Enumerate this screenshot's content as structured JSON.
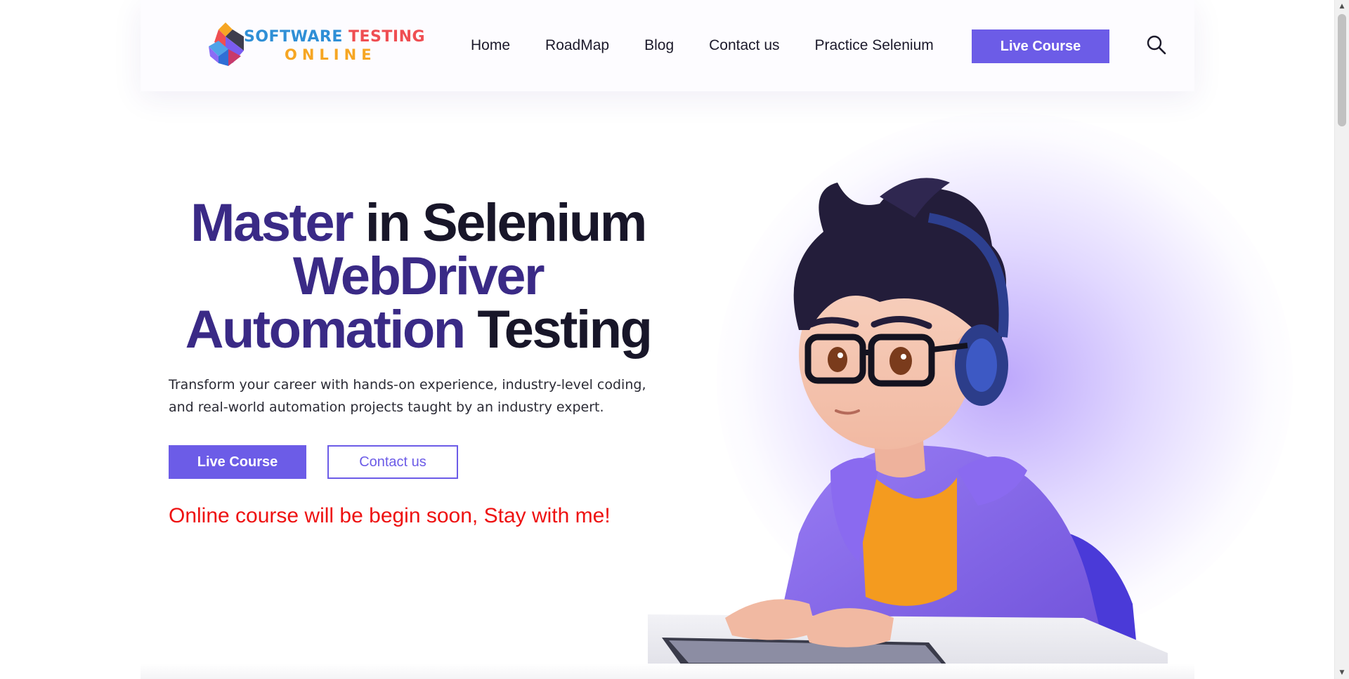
{
  "header": {
    "logo": {
      "line1_part1": "SOFTWARE ",
      "line1_part2": "TESTING",
      "line2": "ONLINE"
    },
    "nav": [
      "Home",
      "RoadMap",
      "Blog",
      "Contact us",
      "Practice Selenium"
    ],
    "cta_label": "Live Course",
    "search_icon": "search-icon"
  },
  "hero": {
    "title": {
      "l1_a": "Master",
      "l1_b": " in Selenium",
      "l2": "WebDriver",
      "l3_a": "Automation",
      "l3_b": " Testing"
    },
    "subtitle": "Transform your career with hands-on experience, industry-level coding, and real-world automation projects taught by an industry expert.",
    "primary_button": "Live Course",
    "secondary_button": "Contact us",
    "notice": "Online course will be begin soon, Stay with me!",
    "illustration": "boy-with-headphones-at-keyboard"
  },
  "colors": {
    "accent": "#6c5ce7",
    "title_highlight": "#3a2a86",
    "title_dark": "#181629",
    "notice": "#ee1111",
    "logo_blue": "#2f8fd6",
    "logo_red": "#ef4e52",
    "logo_orange": "#f6a623"
  },
  "scrollbar": {
    "up_arrow": "▲",
    "down_arrow": "▼"
  }
}
